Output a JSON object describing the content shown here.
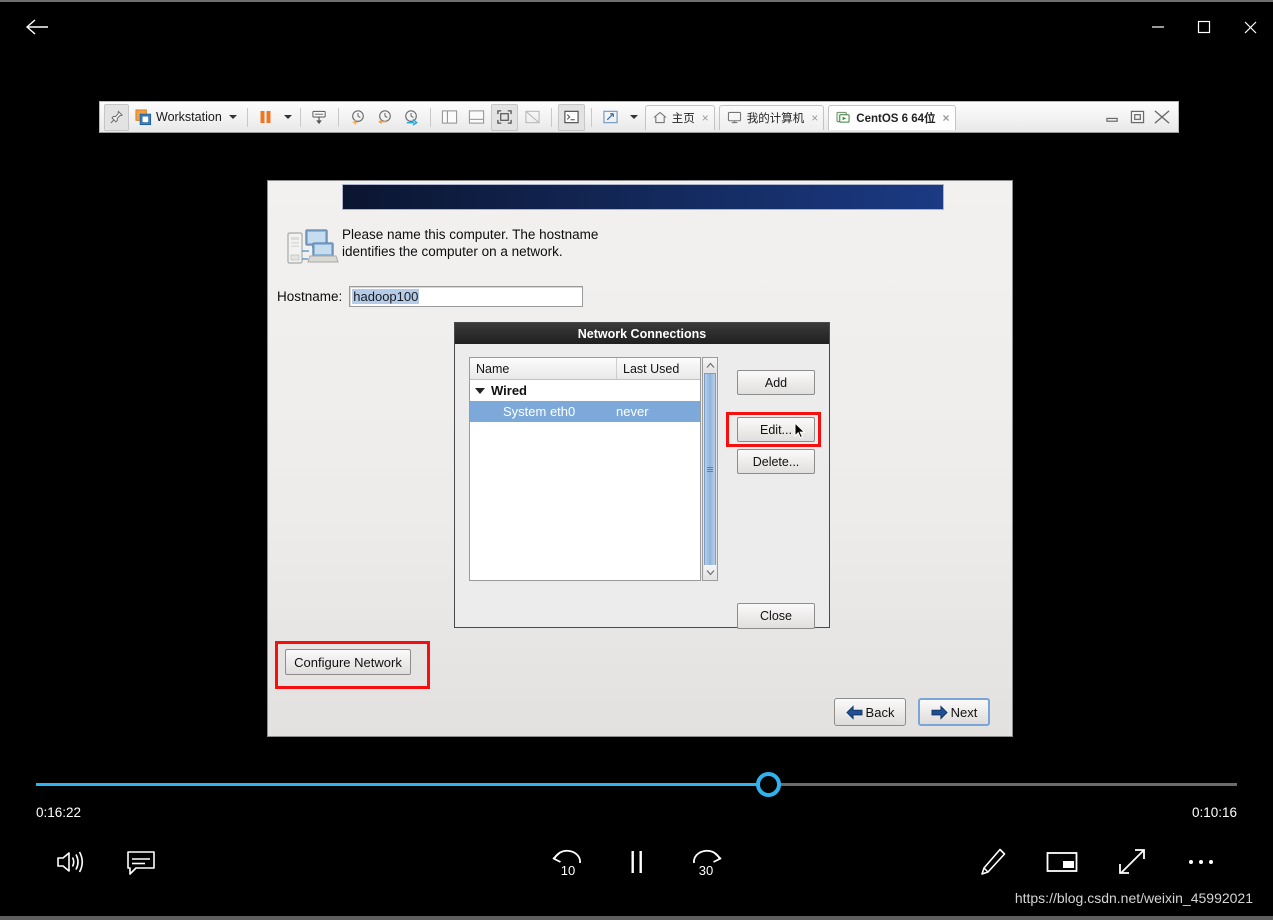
{
  "window": {
    "back_tooltip": "Back",
    "minimize": "Minimize",
    "maximize": "Maximize",
    "close": "Close"
  },
  "vmware": {
    "pin_icon": "pin-icon",
    "app_icon": "vmware-logo-icon",
    "app_menu_label": "Workstation",
    "pause_icon": "pause-icon",
    "send_ctrl_alt_del_icon": "send-keys-icon",
    "snapshot_take_icon": "take-snapshot-icon",
    "snapshot_revert_icon": "revert-snapshot-icon",
    "snapshot_manage_icon": "manage-snapshots-icon",
    "view_sidebar_icon": "show-library-icon",
    "view_thumbnail_icon": "show-thumbnail-bar-icon",
    "view_fullscreen_icon": "enter-fullscreen-icon",
    "view_unity_icon": "unity-mode-icon",
    "console_icon": "console-view-icon",
    "stretch_icon": "stretch-guest-icon",
    "tabs": [
      {
        "label": "主页",
        "icon": "home-icon",
        "active": false,
        "close": "×"
      },
      {
        "label": "我的计算机",
        "icon": "monitor-icon",
        "active": false,
        "close": "×"
      },
      {
        "label": "CentOS 6 64位",
        "icon": "vm-powered-on-icon",
        "active": true,
        "close": "×"
      }
    ],
    "wctrl_minimize": "minimize-icon",
    "wctrl_restore": "restore-icon",
    "wctrl_close": "close-icon"
  },
  "installer": {
    "description": "Please name this computer.  The hostname identifies the computer on a network.",
    "hostname_label": "Hostname:",
    "hostname_value": "hadoop100",
    "configure_network_label": "Configure Network",
    "back_label": "Back",
    "next_label": "Next",
    "computer_icon": "computer-network-icon"
  },
  "network_dialog": {
    "title": "Network Connections",
    "columns": [
      "Name",
      "Last Used"
    ],
    "group": {
      "label": "Wired",
      "expanded": true
    },
    "rows": [
      {
        "name": "System eth0",
        "last_used": "never",
        "selected": true
      }
    ],
    "buttons": {
      "add": "Add",
      "edit": "Edit...",
      "delete": "Delete...",
      "close": "Close"
    },
    "scroll_up_icon": "chevron-up-icon",
    "scroll_down_icon": "chevron-down-icon"
  },
  "player": {
    "current_time": "0:16:22",
    "remaining_time": "0:10:16",
    "progress_percent": 61,
    "volume_icon": "volume-high-icon",
    "captions_icon": "closed-captions-icon",
    "rewind_label": "10",
    "forward_label": "30",
    "play_pause_icon": "pause-icon",
    "draw_icon": "pencil-icon",
    "mini_player_icon": "mini-player-icon",
    "fullscreen_icon": "fullscreen-icon",
    "more_icon": "more-options-icon"
  },
  "watermark": "https://blog.csdn.net/weixin_45992021",
  "colors": {
    "accent": "#2eb3f0",
    "highlight_box": "#f50f0f",
    "selection": "#7ca9da",
    "banner_start": "#0b1530",
    "banner_end": "#1b3a83"
  }
}
